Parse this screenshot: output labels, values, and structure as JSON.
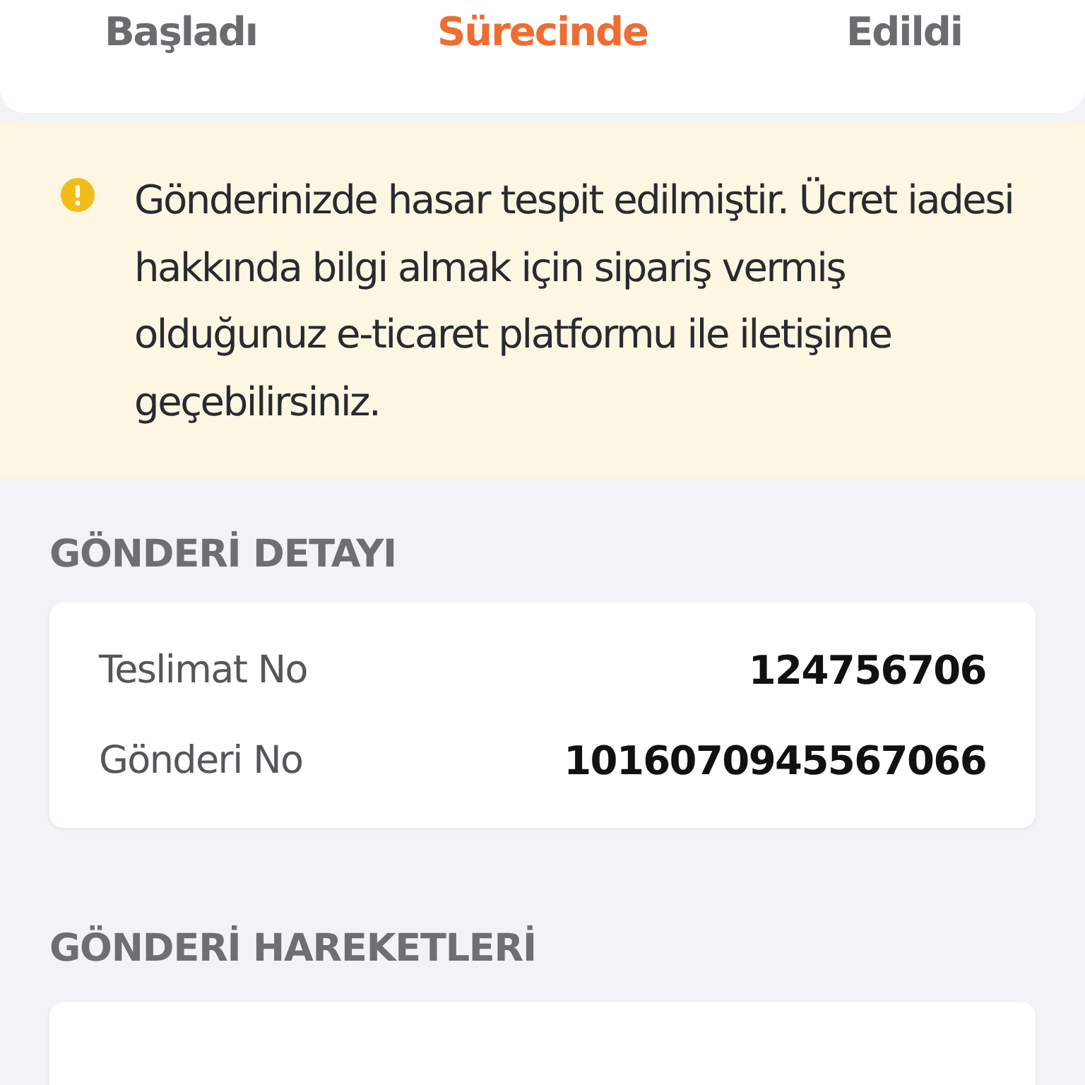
{
  "tabs": [
    {
      "label": "Başladı",
      "selected": false
    },
    {
      "label": "Sürecinde",
      "selected": true
    },
    {
      "label": "Edildi",
      "selected": false
    }
  ],
  "alert": {
    "message": "Gönderinizde hasar tespit edilmiştir. Ücret iadesi hakkında bilgi almak için sipariş vermiş olduğunuz e-ticaret platformu ile iletişime geçebilirsiniz."
  },
  "details": {
    "title": "GÖNDERİ DETAYI",
    "rows": [
      {
        "label": "Teslimat No",
        "value": "124756706"
      },
      {
        "label": "Gönderi No",
        "value": "1016070945567066"
      }
    ]
  },
  "movements": {
    "title": "GÖNDERİ HAREKETLERİ"
  }
}
